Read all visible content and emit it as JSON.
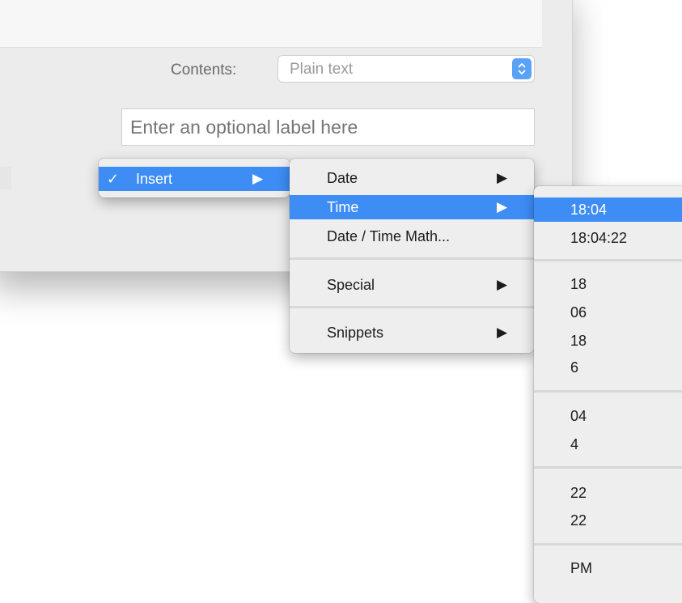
{
  "form": {
    "contents_label": "Contents:",
    "contents_value": "Plain text",
    "label_placeholder": "Enter an optional label here"
  },
  "menus": {
    "level1": {
      "check": "✓",
      "insert_label": "Insert",
      "arrow": "▶"
    },
    "level2": {
      "arrow": "▶",
      "items": [
        "Date",
        "Time",
        "Date / Time Math...",
        "Special",
        "Snippets"
      ]
    },
    "level3": {
      "items": [
        "18:04",
        "18:04:22",
        "18",
        "06",
        "18",
        "6",
        "04",
        "4",
        "22",
        "22",
        "PM"
      ]
    }
  },
  "colors": {
    "highlight": "#3d8df5",
    "menu_bg": "#eeeeee",
    "accent": "#5aa2f8"
  },
  "icons": {
    "stepper": "up-down-chevron-icon",
    "submenu": "right-triangle-icon",
    "check": "checkmark-icon"
  }
}
